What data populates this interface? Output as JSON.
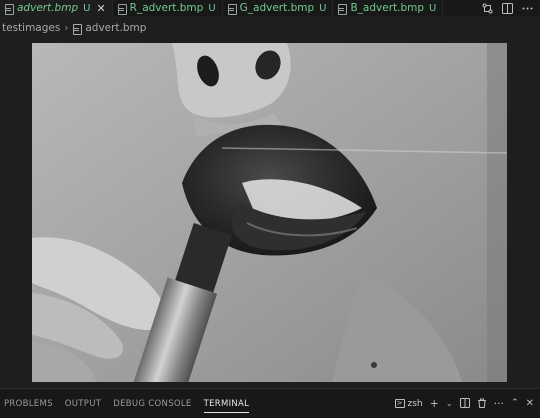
{
  "tabs": [
    {
      "name": "advert.bmp",
      "badge": "U",
      "active": true,
      "close": "✕"
    },
    {
      "name": "R_advert.bmp",
      "badge": "U",
      "active": false
    },
    {
      "name": "G_advert.bmp",
      "badge": "U",
      "active": false
    },
    {
      "name": "B_advert.bmp",
      "badge": "U",
      "active": false
    }
  ],
  "tab_actions": [
    "compare-icon",
    "split-editor-icon",
    "more-icon"
  ],
  "breadcrumb": {
    "folder": "testimages",
    "separator": "›",
    "file": "advert.bmp"
  },
  "panel": {
    "tabs": [
      "PROBLEMS",
      "OUTPUT",
      "DEBUG CONSOLE",
      "TERMINAL"
    ],
    "active_tab": "TERMINAL",
    "shell": "zsh"
  },
  "colors": {
    "editor_bg": "#1e1e1e",
    "tabbar_bg": "#181818",
    "untracked": "#73c991"
  }
}
